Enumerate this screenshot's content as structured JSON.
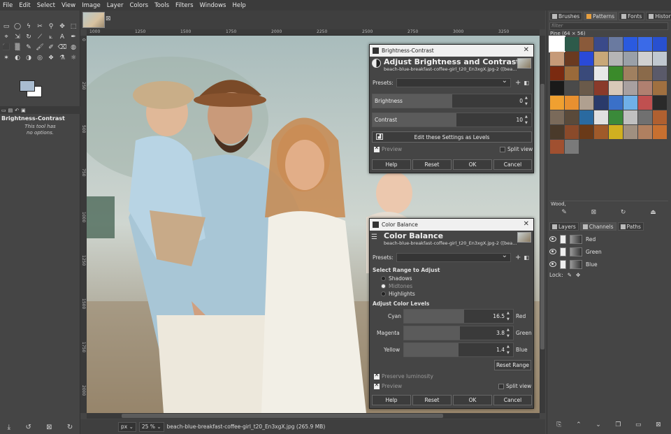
{
  "menubar": [
    "File",
    "Edit",
    "Select",
    "View",
    "Image",
    "Layer",
    "Colors",
    "Tools",
    "Filters",
    "Windows",
    "Help"
  ],
  "toolbox": {
    "tools": [
      "▭",
      "◯",
      "ϟ",
      "✂",
      "⚲",
      "✥",
      "⬚",
      "⌖",
      "⇲",
      "↻",
      "⟋",
      "⟀",
      "A",
      "✒",
      "⬛",
      "▒",
      "✎",
      "🖌",
      "✐",
      "⌫",
      "◍",
      "✶",
      "◐",
      "◑",
      "◎",
      "❖",
      "⚗",
      "☼"
    ],
    "options_title": "Brightness-Contrast",
    "options_note_1": "This tool has",
    "options_note_2": "no options."
  },
  "image_tab": {
    "close": "⊠"
  },
  "rulers": {
    "h": [
      "1000",
      "1250",
      "1500",
      "1750",
      "2000",
      "2250",
      "2500",
      "2750",
      "3000",
      "3250"
    ],
    "v": [
      "0",
      "250",
      "500",
      "750",
      "1000",
      "1250",
      "1500",
      "1750",
      "2000"
    ]
  },
  "status": {
    "unit": "px",
    "zoom": "25 %",
    "text": "beach-blue-breakfast-coffee-girl_t20_En3xgX.jpg (265.9 MB)"
  },
  "right_panel": {
    "tabs": [
      "Brushes",
      "Patterns",
      "Fonts",
      "History"
    ],
    "filter_placeholder": "filter",
    "pattern_label": "Pine (64 × 56)",
    "pattern_name": "Wood,",
    "layers_tabs": [
      "Layers",
      "Channels",
      "Paths"
    ],
    "channels": [
      "Red",
      "Green",
      "Blue"
    ],
    "lock_label": "Lock:"
  },
  "patterns": [
    "#ffffff",
    "#2d5a4a",
    "#8a5a3a",
    "#3a4a8a",
    "#6a7aa0",
    "#2a5adf",
    "#3a6ae8",
    "#2850d0",
    "#c69a78",
    "#6a3a20",
    "#2a4ad8",
    "#c8a878",
    "#b5b5b5",
    "#9aa0a8",
    "#d0d0d0",
    "#c0c8d0",
    "#7a2a10",
    "#9a6a3a",
    "#3a4a7a",
    "#e8e8e8",
    "#3a8a2a",
    "#a08060",
    "#8a6a4a",
    "#5a5a6a",
    "#1a1a1a",
    "#4a4a4a",
    "#6a5a4a",
    "#8a3a2a",
    "#d8c8b8",
    "#a8a0a0",
    "#b08070",
    "#a07040",
    "#f0a030",
    "#e89030",
    "#b0a090",
    "#2a3a6a",
    "#3a70c8",
    "#70b0e8",
    "#c05050",
    "#2a2a2a",
    "#7a6a5a",
    "#5a4a3a",
    "#2a6aa0",
    "#e0e0e0",
    "#3a8a3a",
    "#c0c0c0",
    "#707070",
    "#b06030",
    "#4a3a2a",
    "#8a4a2a",
    "#6a3a18",
    "#a05a2a",
    "#d0b020",
    "#a09080",
    "#b08060",
    "#c87030",
    "#a05030",
    "#7a7a7a"
  ],
  "brightness_contrast": {
    "title": "Brightness-Contrast",
    "heading": "Adjust Brightness and Contrast",
    "subheading": "beach-blue-breakfast-coffee-girl_t20_En3xgX.jpg-2 ([bea...",
    "presets_label": "Presets:",
    "brightness_label": "Brightness",
    "brightness_value": "0",
    "contrast_label": "Contrast",
    "contrast_value": "10",
    "levels_button": "Edit these Settings as Levels",
    "preview_label": "Preview",
    "split_label": "Split view",
    "help": "Help",
    "reset": "Reset",
    "ok": "OK",
    "cancel": "Cancel"
  },
  "color_balance": {
    "title": "Color Balance",
    "heading": "Color Balance",
    "subheading": "beach-blue-breakfast-coffee-girl_t20_En3xgX.jpg-2 ([bea...",
    "presets_label": "Presets:",
    "range_heading": "Select Range to Adjust",
    "ranges": [
      "Shadows",
      "Midtones",
      "Highlights"
    ],
    "levels_heading": "Adjust Color Levels",
    "cyan": "Cyan",
    "red": "Red",
    "cyan_red_value": "16.5",
    "magenta": "Magenta",
    "green": "Green",
    "magenta_green_value": "3.8",
    "yellow": "Yellow",
    "blue": "Blue",
    "yellow_blue_value": "1.4",
    "reset_range": "Reset Range",
    "preserve_label": "Preserve luminosity",
    "preview_label": "Preview",
    "split_label": "Split view",
    "help": "Help",
    "reset": "Reset",
    "ok": "OK",
    "cancel": "Cancel"
  }
}
